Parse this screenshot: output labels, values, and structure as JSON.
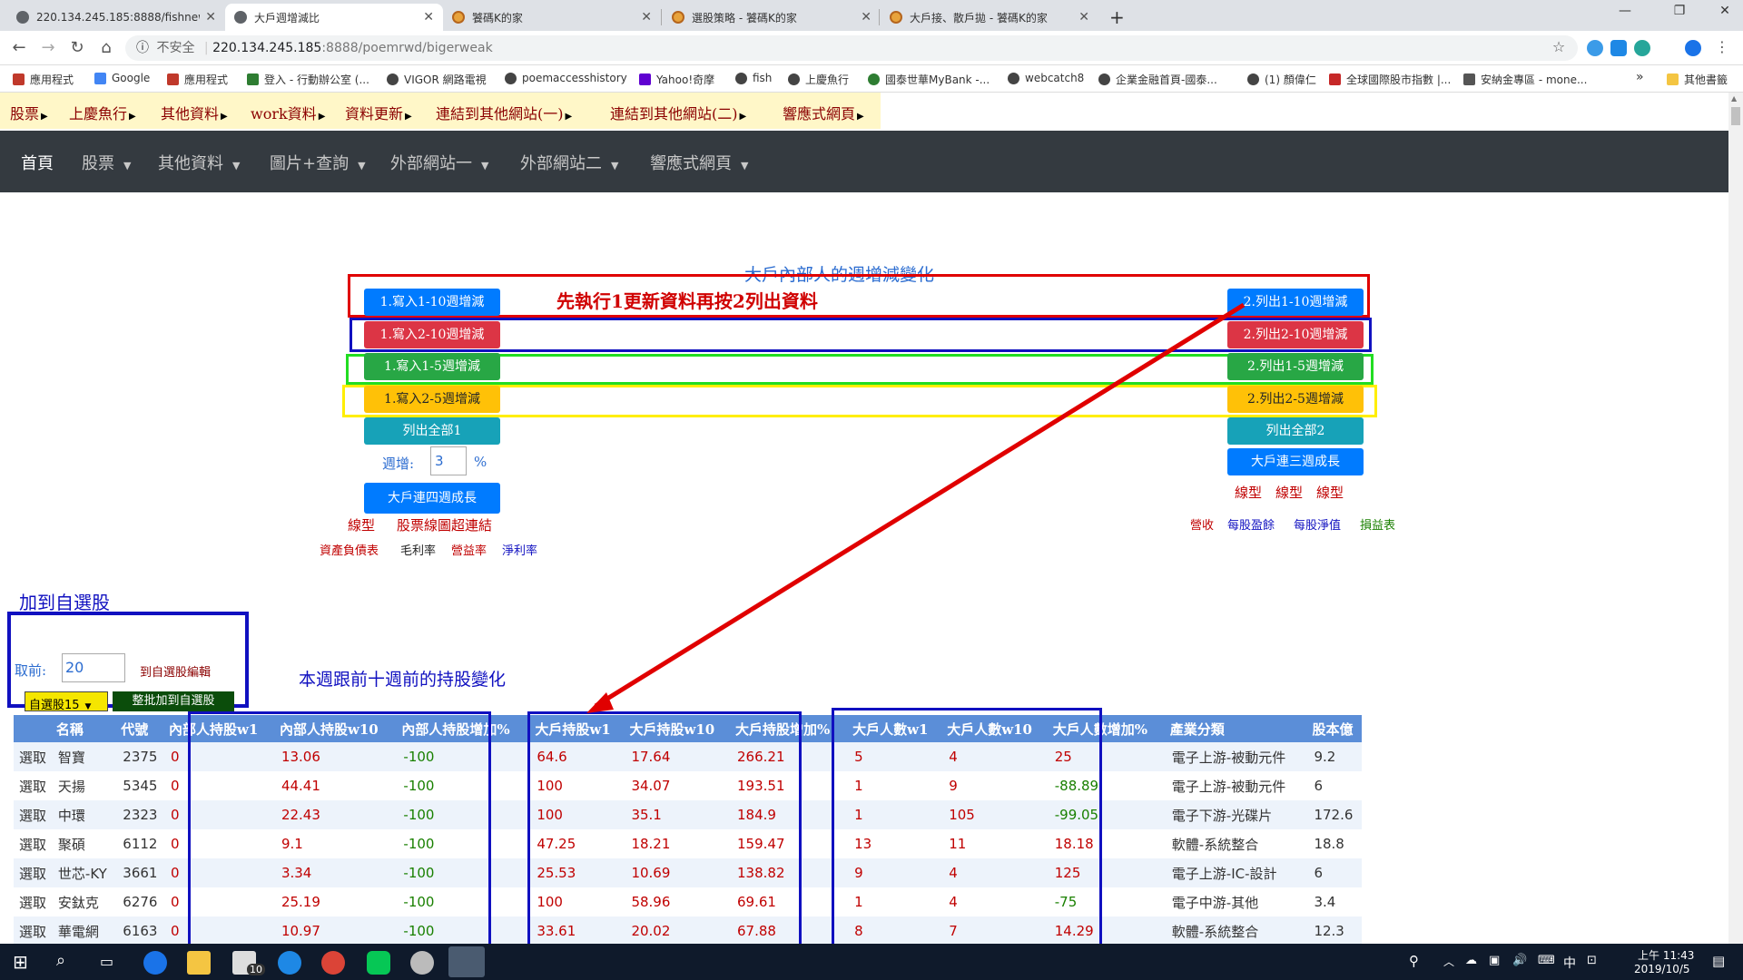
{
  "browser": {
    "tabs": [
      {
        "title": "220.134.245.185:8888/fishnew/"
      },
      {
        "title": "大戶週增減比"
      },
      {
        "title": "饕碼K的家"
      },
      {
        "title": "選股策略 - 饕碼K的家"
      },
      {
        "title": "大戶接、散戶拋 - 饕碼K的家"
      }
    ],
    "new_tab": "+",
    "window_controls": [
      "—",
      "❐",
      "✕"
    ],
    "insecure_label": "不安全",
    "url_host": "220.134.245.185",
    "url_path": ":8888/poemrwd/bigerweak",
    "bookmarks": [
      "應用程式",
      "Google",
      "應用程式",
      "登入 - 行動辦公室 (...",
      "VIGOR 網路電視",
      "poemaccesshistory",
      "Yahoo!奇摩",
      "fish",
      "上慶魚行",
      "國泰世華MyBank -...",
      "webcatch8",
      "企業金融首頁-國泰...",
      "(1) 顏偉仁",
      "全球國際股市指數 |...",
      "安納金專區 - mone..."
    ],
    "bookmarks_more": "»",
    "other_bookmarks": "其他書籤"
  },
  "topmenu": [
    "股票",
    "上慶魚行",
    "其他資料",
    "work資料",
    "資料更新",
    "連結到其他網站(一)",
    "連結到其他網站(二)",
    "響應式網頁"
  ],
  "navbar": {
    "home": "首頁",
    "items": [
      "股票",
      "其他資料",
      "圖片+查詢",
      "外部網站一",
      "外部網站二",
      "響應式網頁"
    ]
  },
  "page": {
    "title": "大戶內部人的週增減變化",
    "instruction": "先執行1更新資料再按2列出資料",
    "left_buttons": [
      "1.寫入1-10週增減",
      "1.寫入2-10週增減",
      "1.寫入1-5週增減",
      "1.寫入2-5週增減",
      "列出全部1"
    ],
    "right_buttons": [
      "2.列出1-10週增減",
      "2.列出2-10週增減",
      "2.列出1-5週增減",
      "2.列出2-5週增減",
      "列出全部2",
      "大戶連三週成長"
    ],
    "weeks_label": "週增:",
    "weeks_value": "3",
    "weeks_unit": "%",
    "four_week_button": "大戶連四週成長",
    "left_links_1": [
      "線型",
      "股票線圖超連結"
    ],
    "left_links_2": [
      "資產負債表",
      "毛利率",
      "營益率",
      "淨利率"
    ],
    "right_links_1": [
      "線型",
      "線型",
      "線型"
    ],
    "right_links_2": [
      "營收",
      "每股盈餘",
      "每股淨值",
      "損益表"
    ],
    "add_watchlist_title": "加到自選股",
    "take_label": "取前:",
    "take_value": "20",
    "watchlist_edit": "到自選股編輯",
    "watchlist_select": "自選股15",
    "batch_add_button": "整批加到自選股",
    "table_title": "本週跟前十週前的持股變化"
  },
  "table": {
    "headers": [
      "",
      "名稱",
      "代號",
      "內部人持股w1",
      "內部人持股w10",
      "內部人持股增加%",
      "大戶持股w1",
      "大戶持股w10",
      "大戶持股增加%",
      "大戶人數w1",
      "大戶人數w10",
      "大戶人數增加%",
      "產業分類",
      "股本億"
    ],
    "rows": [
      [
        "選取",
        "智寶",
        "2375",
        "0",
        "13.06",
        "-100",
        "64.6",
        "17.64",
        "266.21",
        "5",
        "4",
        "25",
        "電子上游-被動元件",
        "9.2"
      ],
      [
        "選取",
        "天揚",
        "5345",
        "0",
        "44.41",
        "-100",
        "100",
        "34.07",
        "193.51",
        "1",
        "9",
        "-88.89",
        "電子上游-被動元件",
        "6"
      ],
      [
        "選取",
        "中環",
        "2323",
        "0",
        "22.43",
        "-100",
        "100",
        "35.1",
        "184.9",
        "1",
        "105",
        "-99.05",
        "電子下游-光碟片",
        "172.6"
      ],
      [
        "選取",
        "聚碩",
        "6112",
        "0",
        "9.1",
        "-100",
        "47.25",
        "18.21",
        "159.47",
        "13",
        "11",
        "18.18",
        "軟體-系統整合",
        "18.8"
      ],
      [
        "選取",
        "世芯-KY",
        "3661",
        "0",
        "3.34",
        "-100",
        "25.53",
        "10.69",
        "138.82",
        "9",
        "4",
        "125",
        "電子上游-IC-設計",
        "6"
      ],
      [
        "選取",
        "安鈦克",
        "6276",
        "0",
        "25.19",
        "-100",
        "100",
        "58.96",
        "69.61",
        "1",
        "4",
        "-75",
        "電子中游-其他",
        "3.4"
      ],
      [
        "選取",
        "華電網",
        "6163",
        "0",
        "10.97",
        "-100",
        "33.61",
        "20.02",
        "67.88",
        "8",
        "7",
        "14.29",
        "軟體-系統整合",
        "12.3"
      ]
    ]
  },
  "colors": {
    "navbar": "#343a40",
    "table_header": "#5b8ed8",
    "frame_red": "#e00000",
    "frame_blue": "#1010c0",
    "frame_green": "#22dd22",
    "frame_yellow": "#ffee00",
    "arrow": "#e00000"
  },
  "taskbar": {
    "badge": "10",
    "time": "上午 11:43",
    "date": "2019/10/5",
    "ime": "中"
  }
}
